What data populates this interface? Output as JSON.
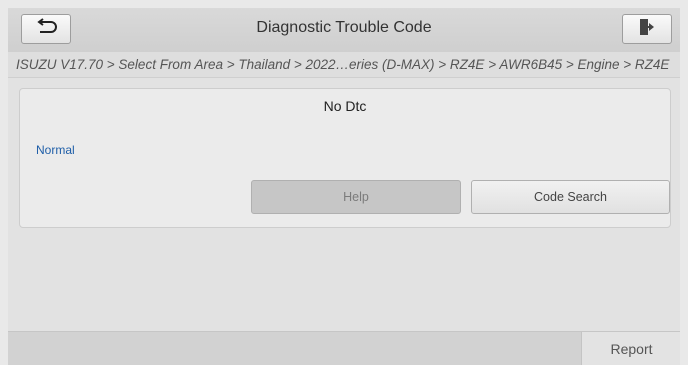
{
  "header": {
    "title": "Diagnostic Trouble Code",
    "back_icon": "back-arrow-icon",
    "exit_icon": "exit-door-icon"
  },
  "breadcrumb": {
    "text": "ISUZU V17.70 > Select From Area > Thailand > 2022…eries (D-MAX) > RZ4E > AWR6B45 > Engine > RZ4E"
  },
  "panel": {
    "dtc_status": "No Dtc",
    "status_text": "Normal",
    "help_label": "Help",
    "code_search_label": "Code Search"
  },
  "footer": {
    "report_label": "Report"
  },
  "colors": {
    "status_text": "#1e5ea8",
    "help_disabled_bg": "#c6c6c6"
  }
}
